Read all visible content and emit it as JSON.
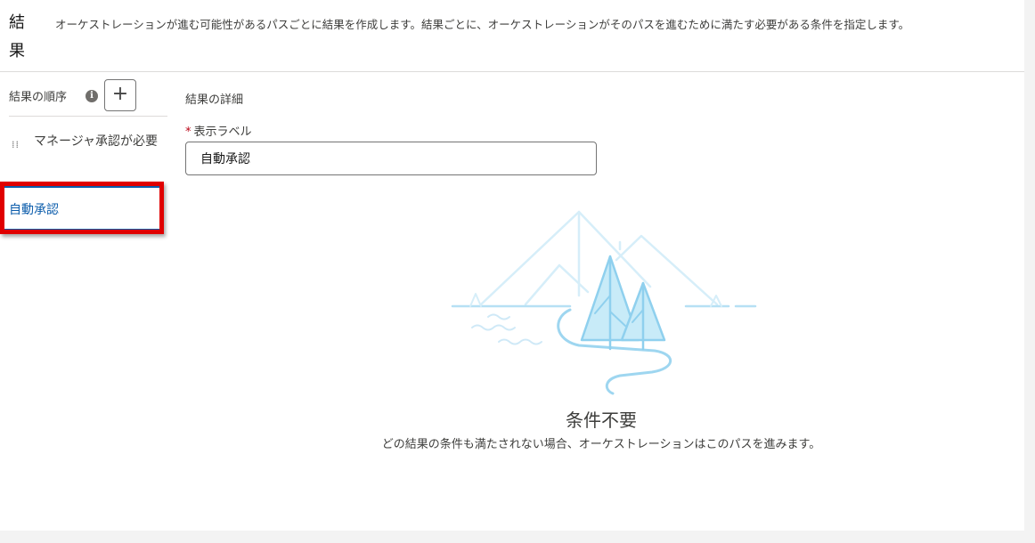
{
  "header": {
    "title_line1": "結",
    "title_line2": "果",
    "description": "オーケストレーションが進む可能性があるパスごとに結果を作成します。結果ごとに、オーケストレーションがそのパスを進むために満たす必要がある条件を指定します。"
  },
  "sidebar": {
    "order_label": "結果の順序",
    "info_icon": "i",
    "add_symbol": "+",
    "items": [
      {
        "label": "マネージャ承認が必要"
      },
      {
        "label": "自動承認"
      }
    ]
  },
  "details": {
    "section_title": "結果の詳細",
    "required_marker": "*",
    "field_label": "表示ラベル",
    "field_value": "自動承認"
  },
  "empty_state": {
    "title": "条件不要",
    "message": "どの結果の条件も満たされない場合、オーケストレーションはこのパスを進みます。"
  },
  "colors": {
    "accent": "#0b5cab",
    "highlight": "#e00000",
    "illustration": "#9ed6f0"
  }
}
